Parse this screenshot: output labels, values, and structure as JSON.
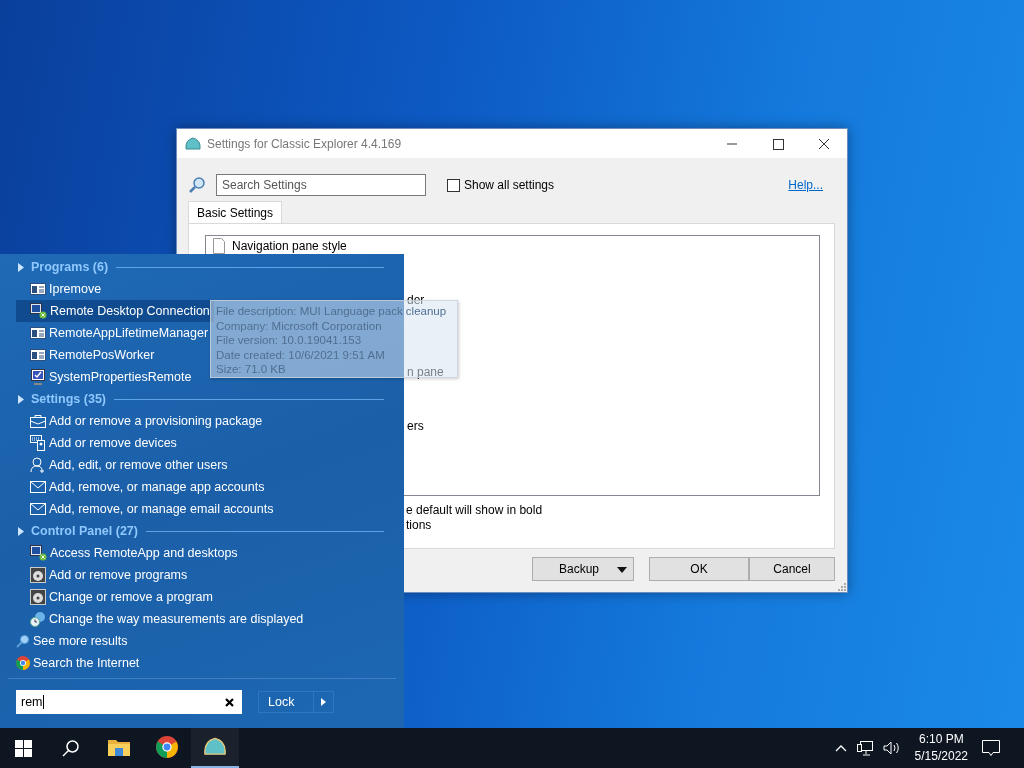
{
  "dialog": {
    "title": "Settings for Classic Explorer 4.4.169",
    "search": {
      "placeholder": "Search Settings"
    },
    "show_all": {
      "label": "Show all settings",
      "checked": false
    },
    "help_link": "Help...",
    "tabs": [
      {
        "label": "Basic Settings",
        "selected": true
      }
    ],
    "settings_items": [
      "Navigation pane style",
      "der",
      "n pane",
      "ers"
    ],
    "notes": [
      "e default will show in bold",
      "tions"
    ],
    "buttons": [
      {
        "label": "Backup",
        "kind": "split"
      },
      {
        "label": "OK",
        "kind": "plain"
      },
      {
        "label": "Cancel",
        "kind": "plain"
      }
    ]
  },
  "start_menu": {
    "groups": [
      {
        "title": "Programs (6)",
        "items": [
          {
            "label": "Ipremove",
            "kind": "app",
            "selected": false
          },
          {
            "label": "Remote Desktop Connection",
            "kind": "remote",
            "selected": true
          },
          {
            "label": "RemoteAppLifetimeManager",
            "kind": "app",
            "selected": false
          },
          {
            "label": "RemotePosWorker",
            "kind": "app",
            "selected": false
          },
          {
            "label": "SystemPropertiesRemote",
            "kind": "system",
            "selected": false
          }
        ]
      },
      {
        "title": "Settings (35)",
        "items": [
          {
            "label": "Add or remove a provisioning package",
            "kind": "package",
            "selected": false
          },
          {
            "label": "Add or remove devices",
            "kind": "devices",
            "selected": false
          },
          {
            "label": "Add, edit, or remove other users",
            "kind": "user",
            "selected": false
          },
          {
            "label": "Add, remove, or manage app accounts",
            "kind": "mail",
            "selected": false
          },
          {
            "label": "Add, remove, or manage email accounts",
            "kind": "mail",
            "selected": false
          }
        ]
      },
      {
        "title": "Control Panel (27)",
        "items": [
          {
            "label": "Access RemoteApp and desktops",
            "kind": "remote",
            "selected": false
          },
          {
            "label": "Add or remove programs",
            "kind": "programs",
            "selected": false
          },
          {
            "label": "Change or remove a program",
            "kind": "programs",
            "selected": false
          },
          {
            "label": "Change the way measurements are displayed",
            "kind": "region",
            "selected": false
          }
        ]
      }
    ],
    "links": [
      {
        "label": "See more results",
        "kind": "search"
      },
      {
        "label": "Search the Internet",
        "kind": "browser"
      }
    ],
    "search": {
      "value": "rem"
    },
    "power_button": "Lock"
  },
  "tooltip": [
    "File description: MUI Language pack cleanup",
    "Company: Microsoft Corporation",
    "File version: 10.0.19041.153",
    "Date created: 10/6/2021 9:51 AM",
    "Size: 71.0 KB"
  ],
  "taskbar": {
    "apps": [
      {
        "kind": "folder",
        "active": false
      },
      {
        "kind": "browser",
        "active": false
      },
      {
        "kind": "shell",
        "active": true
      }
    ],
    "time": "6:10 PM",
    "date": "5/15/2022"
  }
}
